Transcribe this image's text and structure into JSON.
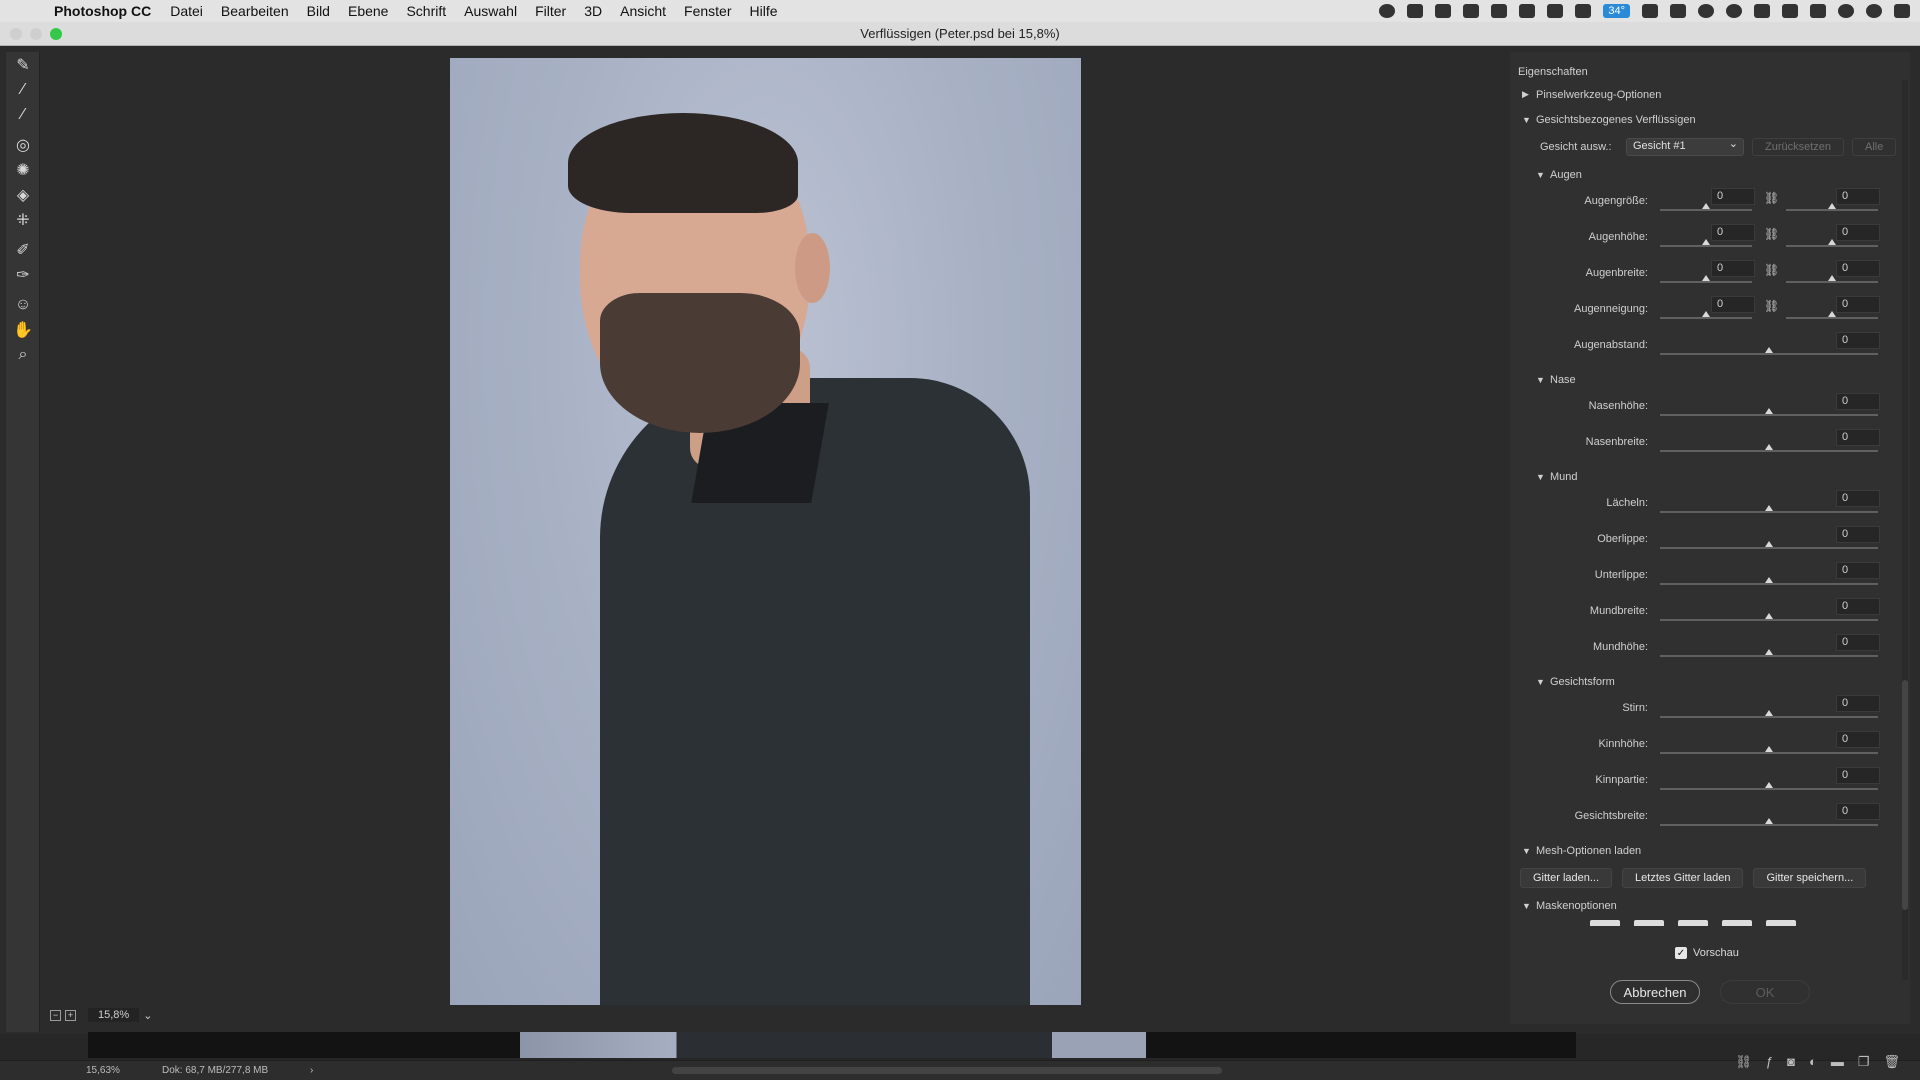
{
  "menubar": {
    "app_name": "Photoshop CC",
    "items": [
      "Datei",
      "Bearbeiten",
      "Bild",
      "Ebene",
      "Schrift",
      "Auswahl",
      "Filter",
      "3D",
      "Ansicht",
      "Fenster",
      "Hilfe"
    ],
    "temperature_badge": "34°"
  },
  "window": {
    "title": "Verflüssigen (Peter.psd bei 15,8%)",
    "traffic_colors": {
      "close": "#cfcfcf",
      "minimize": "#cfcfcf",
      "zoom": "#34c84a"
    }
  },
  "tools": [
    {
      "name": "forward-warp-tool-icon",
      "glyph": "✎"
    },
    {
      "name": "reconstruct-tool-icon",
      "glyph": "⁄"
    },
    {
      "name": "smooth-tool-icon",
      "glyph": "∕"
    },
    {
      "name": "twirl-tool-icon",
      "glyph": "◎"
    },
    {
      "name": "pucker-tool-icon",
      "glyph": "✺"
    },
    {
      "name": "bloat-tool-icon",
      "glyph": "◈"
    },
    {
      "name": "push-left-tool-icon",
      "glyph": "⁜"
    },
    {
      "name": "freeze-mask-tool-icon",
      "glyph": "✐"
    },
    {
      "name": "thaw-mask-tool-icon",
      "glyph": "✑"
    },
    {
      "name": "face-tool-icon",
      "glyph": "☺"
    },
    {
      "name": "hand-tool-icon",
      "glyph": "✋"
    },
    {
      "name": "zoom-tool-icon",
      "glyph": "⌕"
    }
  ],
  "canvas": {
    "zoom_value": "15,8%"
  },
  "panel": {
    "title": "Eigenschaften",
    "sections": {
      "brush": "Pinselwerkzeug-Optionen",
      "face": "Gesichtsbezogenes Verflüssigen",
      "mesh": "Mesh-Optionen laden",
      "mask": "Maskenoptionen"
    },
    "face_select": {
      "label": "Gesicht ausw.:",
      "value": "Gesicht #1",
      "reset": "Zurücksetzen",
      "all": "Alle"
    },
    "eyes": {
      "title": "Augen",
      "rows": [
        {
          "label": "Augengröße:",
          "left": "0",
          "right": "0"
        },
        {
          "label": "Augenhöhe:",
          "left": "0",
          "right": "0"
        },
        {
          "label": "Augenbreite:",
          "left": "0",
          "right": "0"
        },
        {
          "label": "Augenneigung:",
          "left": "0",
          "right": "0"
        }
      ],
      "distance": {
        "label": "Augenabstand:",
        "value": "0"
      }
    },
    "nose": {
      "title": "Nase",
      "rows": [
        {
          "label": "Nasenhöhe:",
          "value": "0"
        },
        {
          "label": "Nasenbreite:",
          "value": "0"
        }
      ]
    },
    "mouth": {
      "title": "Mund",
      "rows": [
        {
          "label": "Lächeln:",
          "value": "0"
        },
        {
          "label": "Oberlippe:",
          "value": "0"
        },
        {
          "label": "Unterlippe:",
          "value": "0"
        },
        {
          "label": "Mundbreite:",
          "value": "0"
        },
        {
          "label": "Mundhöhe:",
          "value": "0"
        }
      ]
    },
    "faceshape": {
      "title": "Gesichtsform",
      "rows": [
        {
          "label": "Stirn:",
          "value": "0"
        },
        {
          "label": "Kinnhöhe:",
          "value": "0"
        },
        {
          "label": "Kinnpartie:",
          "value": "0"
        },
        {
          "label": "Gesichtsbreite:",
          "value": "0"
        }
      ]
    },
    "mesh_buttons": {
      "load": "Gitter laden...",
      "last": "Letztes Gitter laden",
      "save": "Gitter speichern..."
    },
    "preview_label": "Vorschau",
    "cancel_label": "Abbrechen",
    "ok_label": "OK"
  },
  "status": {
    "zoom": "15,63%",
    "doc": "Dok: 68,7 MB/277,8 MB"
  }
}
